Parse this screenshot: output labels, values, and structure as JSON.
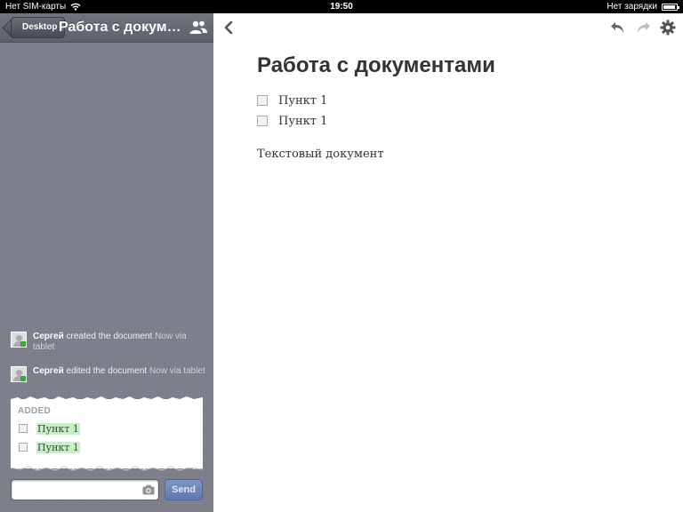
{
  "status_bar": {
    "carrier": "Нет SIM-карты",
    "time": "19:50",
    "battery_text": "Нет зарядки",
    "battery_level": 0.9
  },
  "sidebar": {
    "back_label": "Desktop",
    "title": "Работа с докуме…",
    "activities": [
      {
        "user": "Сергей",
        "action": "created the document",
        "meta": "Now via tablet"
      },
      {
        "user": "Сергей",
        "action": "edited the document",
        "meta": "Now via tablet"
      }
    ],
    "change_card": {
      "heading": "ADDED",
      "items": [
        {
          "label": "Пункт 1"
        },
        {
          "label": "Пункт 1"
        }
      ]
    },
    "composer": {
      "placeholder": "",
      "send_label": "Send"
    }
  },
  "document": {
    "title": "Работа с документами",
    "checklist": [
      {
        "label": "Пункт 1",
        "checked": false
      },
      {
        "label": "Пункт 1",
        "checked": false
      }
    ],
    "body_text": "Текстовый документ"
  },
  "colors": {
    "sidebar_bg": "#7d808b",
    "added_highlight": "#c9efc6",
    "send_button": "#6d86ba",
    "online_dot": "#38a838"
  },
  "icons": [
    "wifi-icon",
    "people-icon",
    "camera-icon",
    "chevron-left-icon",
    "undo-icon",
    "redo-icon",
    "gear-icon"
  ]
}
